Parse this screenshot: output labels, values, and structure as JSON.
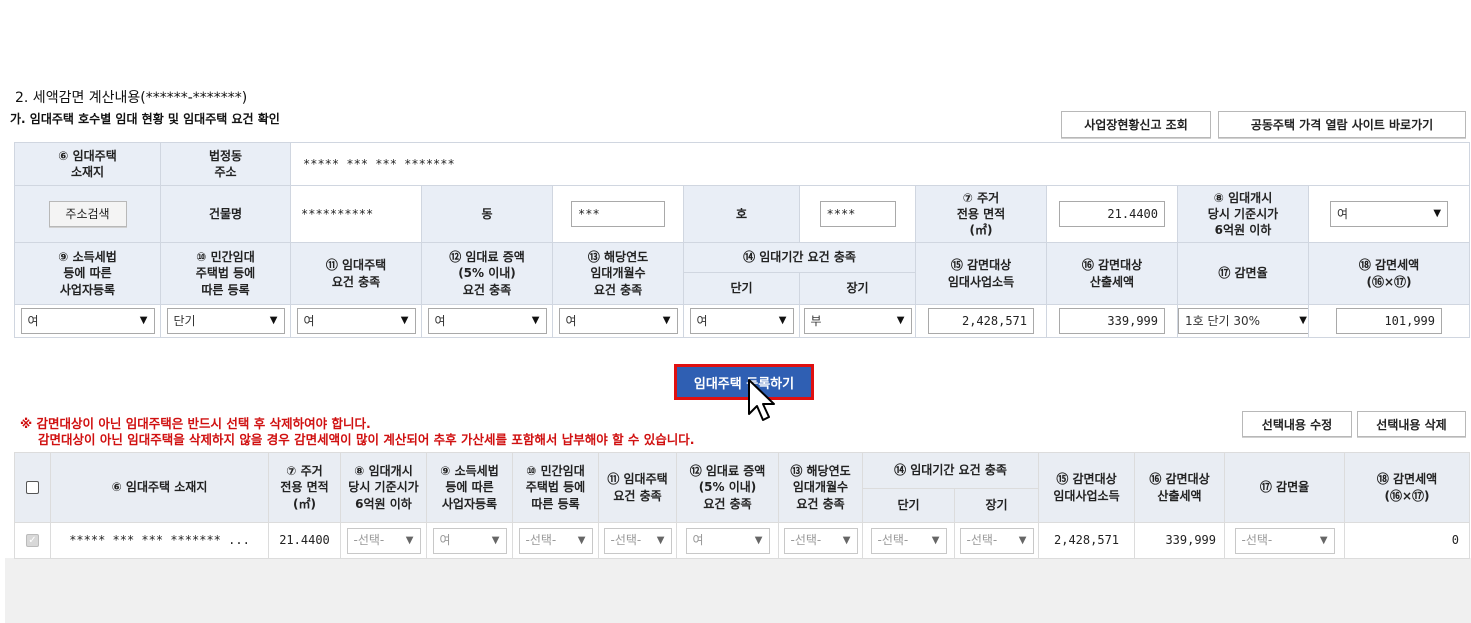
{
  "section": {
    "title": "2. 세액감면 계산내용(******-*******)",
    "subtitle": "가. 임대주택 호수별 임대 현황 및 임대주택 요건 확인"
  },
  "buttons": {
    "business_lookup": "사업장현황신고 조회",
    "price_site": "공동주택 가격 열람 사이트 바로가기",
    "address_search": "주소검색",
    "register": "임대주택 등록하기",
    "edit_selected": "선택내용 수정",
    "delete_selected": "선택내용 삭제"
  },
  "form": {
    "location_label": "⑥ 임대주택\n소재지",
    "legal_address_label": "법정동\n주소",
    "legal_address_value": "***** *** *** *******",
    "building_label": "건물명",
    "building_value": "**********",
    "dong_label": "동",
    "dong_value": "***",
    "ho_label": "호",
    "ho_value": "****",
    "area_label": "⑦ 주거\n전용 면적\n(㎡)",
    "area_value": "21.4400",
    "price_label": "⑧ 임대개시\n당시 기준시가\n6억원 이하",
    "price_value": "여",
    "h9": "⑨ 소득세법\n등에 따른\n사업자등록",
    "h10": "⑩ 민간임대\n주택법 등에\n따른 등록",
    "h11": "⑪ 임대주택\n요건 충족",
    "h12": "⑫ 임대료 증액\n(5% 이내)\n요건 충족",
    "h13": "⑬ 해당연도\n임대개월수\n요건 충족",
    "h14": "⑭ 임대기간 요건 충족",
    "h14_short": "단기",
    "h14_long": "장기",
    "h15": "⑮ 감면대상\n임대사업소득",
    "h16": "⑯ 감면대상\n산출세액",
    "h17": "⑰ 감면율",
    "h18": "⑱ 감면세액\n(⑯×⑰)",
    "v9": "여",
    "v10": "단기",
    "v11": "여",
    "v12": "여",
    "v13": "여",
    "v14_short": "여",
    "v14_long": "부",
    "v15": "2,428,571",
    "v16": "339,999",
    "v17": "1호 단기 30%",
    "v18": "101,999"
  },
  "warning": {
    "line1": "※ 감면대상이 아닌 임대주택은 반드시 선택 후 삭제하여야 합니다.",
    "line2": "감면대상이 아닌 임대주택을 삭제하지 않을 경우 감면세액이 많이 계산되어 추후 가산세를 포함해서 납부해야 할 수 있습니다."
  },
  "list": {
    "headers": {
      "location": "⑥ 임대주택 소재지",
      "area": "⑦ 주거\n전용 면적\n(㎡)",
      "price": "⑧ 임대개시\n당시 기준시가\n6억원 이하",
      "reg9": "⑨ 소득세법\n등에 따른\n사업자등록",
      "reg10": "⑩ 민간임대\n주택법 등에\n따른 등록",
      "h11": "⑪ 임대주택\n요건 충족",
      "h12": "⑫ 임대료 증액\n(5% 이내)\n요건 충족",
      "h13": "⑬ 해당연도\n임대개월수\n요건 충족",
      "h14": "⑭ 임대기간 요건 충족",
      "short": "단기",
      "long": "장기",
      "h15": "⑮ 감면대상\n임대사업소득",
      "h16": "⑯ 감면대상\n산출세액",
      "h17": "⑰ 감면율",
      "h18": "⑱ 감면세액\n(⑯×⑰)"
    },
    "row": {
      "location": "***** *** *** ******* ...",
      "area": "21.4400",
      "price": "-선택-",
      "reg9": "여",
      "reg10": "-선택-",
      "h11": "-선택-",
      "h12": "여",
      "h13": "-선택-",
      "short": "-선택-",
      "long": "-선택-",
      "h15": "2,428,571",
      "h16": "339,999",
      "h17": "-선택-",
      "h18": "0"
    }
  },
  "colors": {
    "header_bg": "#e9eef6",
    "register_button": "#2f5fb3",
    "warning_text": "#d01010"
  }
}
